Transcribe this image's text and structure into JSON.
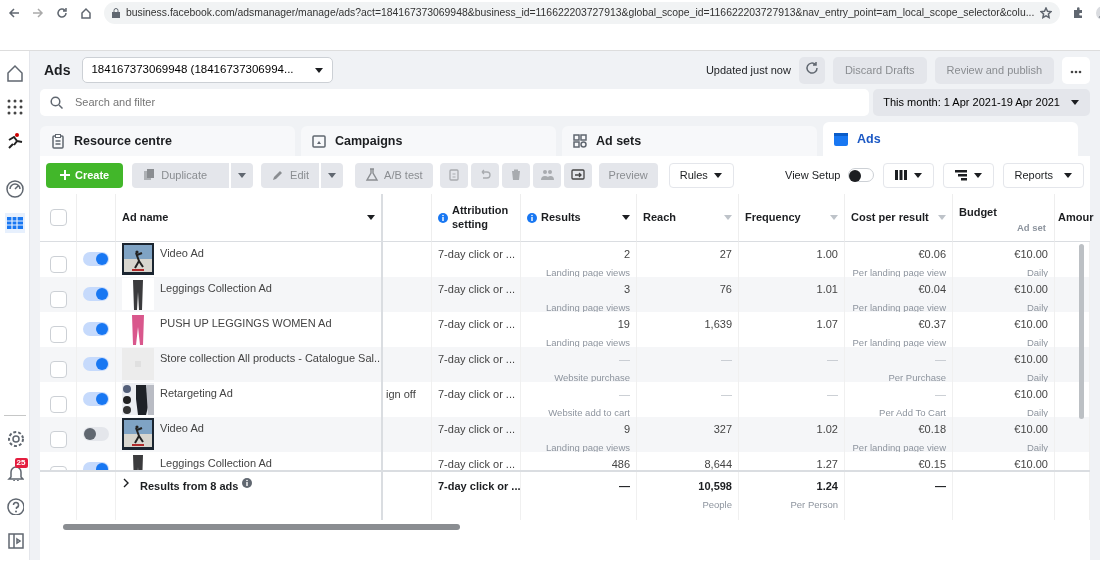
{
  "browser": {
    "url": "business.facebook.com/adsmanager/manage/ads?act=184167373069948&business_id=116622203727913&global_scope_id=116622203727913&nav_entry_point=am_local_scope_selector&colu..."
  },
  "sidebar": {
    "items": [
      {
        "kind": "home",
        "selected": false
      },
      {
        "kind": "apps",
        "selected": false
      },
      {
        "kind": "logo",
        "selected": false
      },
      {
        "kind": "gauge",
        "selected": false
      },
      {
        "kind": "table",
        "selected": true
      }
    ],
    "bottom_items": [
      {
        "kind": "settings"
      },
      {
        "kind": "bell",
        "badge": "25"
      },
      {
        "kind": "help"
      },
      {
        "kind": "panel"
      }
    ]
  },
  "header": {
    "title": "Ads",
    "account": "184167373069948 (18416737306994...",
    "status": "Updated just now",
    "buttons": [
      {
        "label": "Discard Drafts",
        "disabled": true
      },
      {
        "label": "Review and publish",
        "disabled": true
      }
    ]
  },
  "search": {
    "placeholder": "Search and filter"
  },
  "date_range": "This month: 1 Apr 2021-19 Apr 2021",
  "tabs": [
    {
      "label": "Resource centre",
      "kind": "clipboard",
      "selected": false
    },
    {
      "label": "Campaigns",
      "kind": "folder",
      "selected": false
    },
    {
      "label": "Ad sets",
      "kind": "grid",
      "selected": false
    },
    {
      "label": "Ads",
      "kind": "ad",
      "selected": true
    }
  ],
  "toolbar": [
    {
      "kind": "create",
      "label": "Create",
      "disabled": false
    },
    {
      "kind": "duplicate",
      "label": "Duplicate",
      "disabled": true
    },
    {
      "kind": "edit",
      "label": "Edit",
      "disabled": true
    },
    {
      "kind": "abtest",
      "label": "A/B test",
      "disabled": true
    },
    {
      "kind": "clipboard",
      "disabled": true
    },
    {
      "kind": "undo",
      "disabled": true
    },
    {
      "kind": "trash",
      "disabled": true
    },
    {
      "kind": "people",
      "disabled": true
    },
    {
      "kind": "export",
      "disabled": false
    },
    {
      "kind": "preview",
      "label": "Preview",
      "disabled": true
    },
    {
      "kind": "rules",
      "label": "Rules",
      "disabled": false
    }
  ],
  "view_setup": {
    "label": "View Setup",
    "on": false
  },
  "right_tools": [
    {
      "kind": "columns"
    },
    {
      "kind": "breakdown"
    },
    {
      "kind": "reports",
      "label": "Reports"
    }
  ],
  "table": {
    "select_all": {
      "checked": false
    },
    "columns": [
      {
        "label": "Ad name",
        "kind": "sortable",
        "sorted": true,
        "info": false
      },
      {
        "label": "Attribution setting",
        "kind": "plain",
        "sorted": false,
        "info": true
      },
      {
        "label": "Results",
        "kind": "sortable",
        "sorted": true,
        "info": true
      },
      {
        "label": "Reach",
        "kind": "sortable",
        "sorted": false,
        "info": false
      },
      {
        "label": "Frequency",
        "kind": "sortable",
        "sorted": false,
        "info": false
      },
      {
        "label": "Cost per result",
        "kind": "sortable",
        "sorted": false,
        "info": false
      },
      {
        "label": "Budget",
        "sub": "Ad set",
        "kind": "plain",
        "sorted": false,
        "info": false
      },
      {
        "label": "Amour",
        "kind": "plain",
        "sorted": false,
        "info": false
      }
    ],
    "rows": [
      {
        "selected": false,
        "on": true,
        "name": "Video Ad",
        "attribution": "7-day click or ...",
        "results": "2",
        "results_sub": "Landing page views",
        "reach": "27",
        "frequency": "1.00",
        "cost": "€0.06",
        "cost_sub": "Per landing page view",
        "budget": "€10.00",
        "budget_sub": "Daily"
      },
      {
        "selected": false,
        "on": true,
        "name": "Leggings Collection Ad",
        "attribution": "7-day click or ...",
        "results": "3",
        "results_sub": "Landing page views",
        "reach": "76",
        "frequency": "1.01",
        "cost": "€0.04",
        "cost_sub": "Per landing page view",
        "budget": "€10.00",
        "budget_sub": "Daily"
      },
      {
        "selected": false,
        "on": true,
        "name": "PUSH UP LEGGINGS WOMEN Ad",
        "attribution": "7-day click or ...",
        "results": "19",
        "results_sub": "Landing page views",
        "reach": "1,639",
        "frequency": "1.07",
        "cost": "€0.37",
        "cost_sub": "Per landing page view",
        "budget": "€10.00",
        "budget_sub": "Daily"
      },
      {
        "selected": false,
        "on": true,
        "name": "Store collection All products - Catalogue Sal...",
        "attribution": "7-day click or ...",
        "results": "—",
        "results_sub": "Website purchase",
        "reach": "—",
        "frequency": "—",
        "cost": "—",
        "cost_sub": "Per Purchase",
        "budget": "€10.00",
        "budget_sub": "Daily"
      },
      {
        "selected": false,
        "on": true,
        "name": "Retargeting Ad",
        "column_3": "ign off",
        "attribution": "7-day click or ...",
        "results": "—",
        "results_sub": "Website add to cart",
        "reach": "—",
        "frequency": "—",
        "cost": "—",
        "cost_sub": "Per Add To Cart",
        "budget": "€10.00",
        "budget_sub": "Daily"
      },
      {
        "selected": false,
        "on": false,
        "name": "Video Ad",
        "attribution": "7-day click or ...",
        "results": "9",
        "results_sub": "Landing page views",
        "reach": "327",
        "frequency": "1.02",
        "cost": "€0.18",
        "cost_sub": "Per landing page view",
        "budget": "€10.00",
        "budget_sub": "Daily"
      },
      {
        "selected": false,
        "on": true,
        "name": "Leggings Collection Ad",
        "attribution": "7-day click or ...",
        "results": "486",
        "reach": "8,644",
        "frequency": "1.27",
        "cost": "€0.15",
        "budget": "€10.00"
      }
    ],
    "footer": {
      "label": "Results from 8 ads",
      "attribution": "7-day click or ...",
      "results": "—",
      "reach": "10,598",
      "reach_sub": "People",
      "frequency": "1.24",
      "frequency_sub": "Per Person",
      "cost": "—"
    }
  }
}
